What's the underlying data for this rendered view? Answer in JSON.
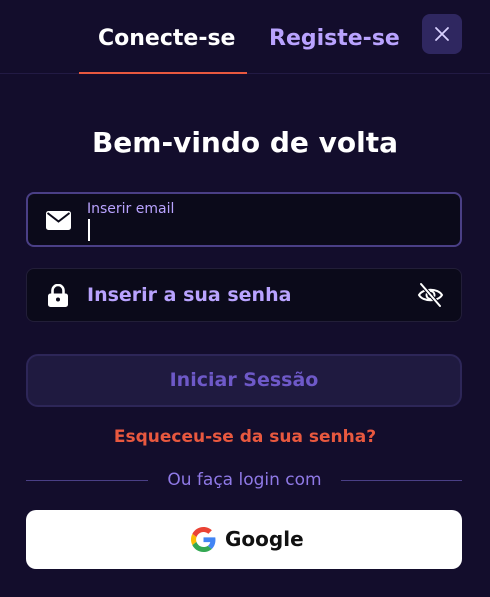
{
  "tabs": {
    "login_label": "Conecte-se",
    "register_label": "Registe-se"
  },
  "close_icon": "close-icon",
  "heading": "Bem-vindo de volta",
  "email_field": {
    "label": "Inserir email",
    "value": "",
    "icon": "envelope-icon"
  },
  "password_field": {
    "placeholder": "Inserir a sua senha",
    "value": "",
    "icon": "lock-icon",
    "toggle_icon": "eye-slash-icon"
  },
  "submit_label": "Iniciar Sessão",
  "forgot_label": "Esqueceu-se da sua senha?",
  "divider_text": "Ou faça login com",
  "google": {
    "label": "Google",
    "icon": "google-icon"
  },
  "colors": {
    "background": "#130d2c",
    "accent": "#e8583f",
    "label": "#b9a3ff",
    "button": "#1f1a40",
    "field": "#0b0a1a"
  }
}
